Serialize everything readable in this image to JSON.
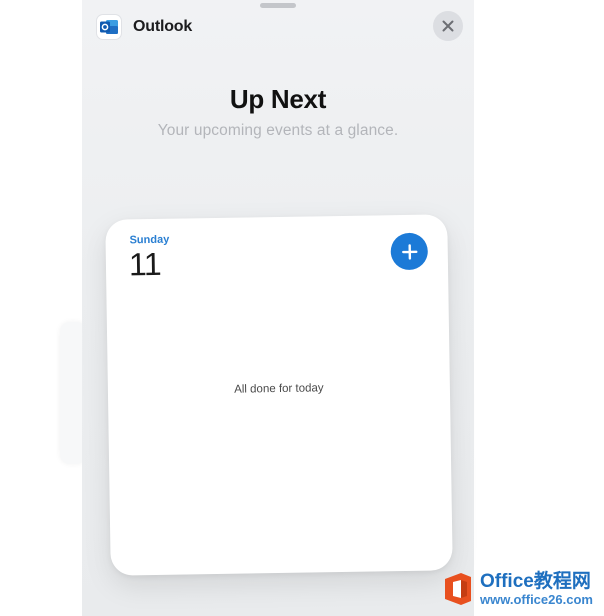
{
  "app": {
    "name": "Outlook",
    "icon": "outlook-icon"
  },
  "controls": {
    "close_icon": "close-icon",
    "add_icon": "plus-icon"
  },
  "gallery": {
    "title": "Up Next",
    "subtitle": "Your upcoming events at a glance."
  },
  "widget": {
    "day_name": "Sunday",
    "day_number": "11",
    "empty_message": "All done for today"
  },
  "watermark": {
    "brand": "Office教程网",
    "url": "www.office26.com"
  },
  "colors": {
    "accent": "#1c7ad7",
    "day_label": "#2a7fd2",
    "watermark_orange": "#e8501f",
    "watermark_blue": "#1e6fbf"
  }
}
